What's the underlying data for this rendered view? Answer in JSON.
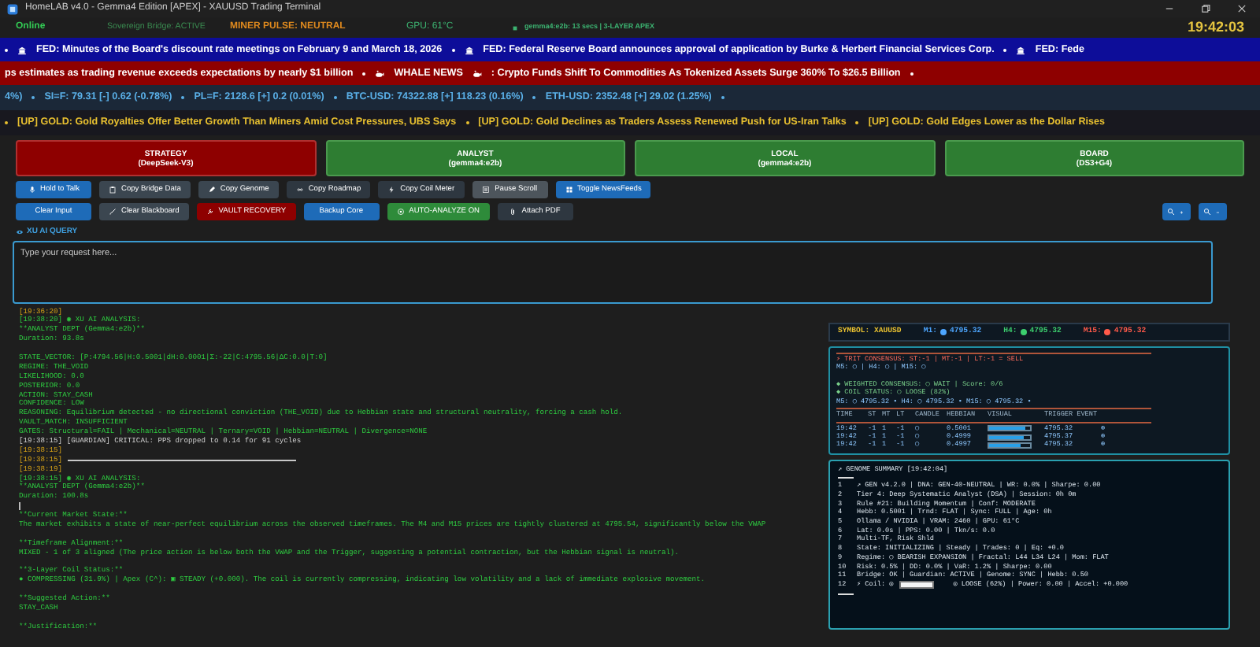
{
  "window": {
    "title": "HomeLAB v4.0 - Gemma4 Edition [APEX] - XAUUSD Trading Terminal"
  },
  "status_bar": [
    {
      "kind": "online",
      "text": "Online"
    },
    {
      "kind": "bridge",
      "text": "Sovereign Bridge: ACTIVE"
    },
    {
      "kind": "pulse",
      "text": "MINER PULSE: NEUTRAL"
    },
    {
      "kind": "gpu",
      "text": "GPU: 61°C"
    },
    {
      "kind": "model",
      "text": "gemma4:e2b: 13 secs | 3-LAYER APEX"
    },
    {
      "kind": "clock",
      "text": "19:42:03"
    }
  ],
  "tickers": [
    {
      "kind": "fed",
      "segments": [
        {
          "kind": "dot"
        },
        {
          "kind": "bank"
        },
        {
          "kind": "text",
          "text": "FED: Minutes of the Board's discount rate meetings on February 9 and March 18, 2026"
        },
        {
          "kind": "dot"
        },
        {
          "kind": "bank"
        },
        {
          "kind": "text",
          "text": "FED: Federal Reserve Board announces approval of application by Burke & Herbert Financial Services Corp."
        },
        {
          "kind": "dot"
        },
        {
          "kind": "bank"
        },
        {
          "kind": "text",
          "text": "FED: Fede"
        }
      ]
    },
    {
      "kind": "whale",
      "segments": [
        {
          "kind": "text",
          "text": "ps estimates as trading revenue exceeds expectations by nearly $1 billion"
        },
        {
          "kind": "dot"
        },
        {
          "kind": "whale"
        },
        {
          "kind": "text",
          "text": "WHALE NEWS"
        },
        {
          "kind": "whale"
        },
        {
          "kind": "text",
          "text": ": Crypto Funds Shift To Commodities As Tokenized Assets Surge 360% To $26.5 Billion"
        },
        {
          "kind": "dot"
        }
      ]
    },
    {
      "kind": "markets",
      "segments": [
        {
          "kind": "text",
          "text": "4%)"
        },
        {
          "kind": "dot"
        },
        {
          "kind": "text",
          "text": "SI=F: 79.31 [-] 0.62 (-0.78%)"
        },
        {
          "kind": "dot"
        },
        {
          "kind": "text",
          "text": "PL=F: 2128.6 [+] 0.2 (0.01%)"
        },
        {
          "kind": "dot"
        },
        {
          "kind": "text",
          "text": "BTC-USD: 74322.88 [+] 118.23 (0.16%)"
        },
        {
          "kind": "dot"
        },
        {
          "kind": "text",
          "text": "ETH-USD: 2352.48 [+] 29.02 (1.25%)"
        },
        {
          "kind": "dot"
        }
      ]
    },
    {
      "kind": "headlines",
      "segments": [
        {
          "kind": "dot"
        },
        {
          "kind": "text",
          "text": "[UP] GOLD: Gold Royalties Offer Better Growth Than Miners Amid Cost Pressures, UBS Says"
        },
        {
          "kind": "dot"
        },
        {
          "kind": "text",
          "text": "[UP] GOLD: Gold Declines as Traders Assess Renewed Push for US-Iran Talks"
        },
        {
          "kind": "dot"
        },
        {
          "kind": "text",
          "text": "[UP] GOLD: Gold Edges Lower as the Dollar Rises"
        }
      ]
    }
  ],
  "agents": [
    {
      "title": "STRATEGY",
      "model": "(DeepSeek-V3)",
      "selected": true
    },
    {
      "title": "ANALYST",
      "model": "(gemma4:e2b)",
      "selected": false
    },
    {
      "title": "LOCAL",
      "model": "(gemma4:e2b)",
      "selected": false
    },
    {
      "title": "BOARD",
      "model": "(DS3+G4)",
      "selected": false
    }
  ],
  "toolbar_rows": [
    [
      {
        "label": "Hold to Talk",
        "kind": "primary"
      },
      {
        "label": "Copy Bridge Data",
        "kind": "secondary"
      },
      {
        "label": "Copy Genome",
        "kind": "secondary"
      },
      {
        "label": "Copy Roadmap",
        "kind": "dark"
      },
      {
        "label": "Copy Coil Meter",
        "kind": "dark"
      },
      {
        "label": "Pause Scroll",
        "kind": "light"
      },
      {
        "label": "Toggle NewsFeeds",
        "kind": "primary"
      }
    ],
    [
      {
        "label": "Clear Input",
        "kind": "primary"
      },
      {
        "label": "Clear Blackboard",
        "kind": "secondary"
      },
      {
        "label": "VAULT RECOVERY",
        "kind": "danger"
      },
      {
        "label": "Backup Core",
        "kind": "primary"
      },
      {
        "label": "AUTO-ANALYZE ON",
        "kind": "success"
      },
      {
        "label": "Attach PDF",
        "kind": "dark"
      }
    ]
  ],
  "zoom_buttons": [
    {
      "kind": "in"
    },
    {
      "kind": "out"
    }
  ],
  "query": {
    "label": "XU AI QUERY",
    "placeholder": "Type your request here..."
  },
  "log": [
    {
      "kind": "time",
      "text": "[19:36:20]"
    },
    {
      "kind": "ai",
      "text": "[19:38:20] ◉ XU AI ANALYSIS:"
    },
    {
      "kind": "ai",
      "text": "**ANALYST DEPT (Gemma4:e2b)**"
    },
    {
      "kind": "ai",
      "text": "Duration: 93.8s"
    },
    {
      "kind": "blank"
    },
    {
      "kind": "ai",
      "text": "STATE_VECTOR: [P:4794.56|H:0.5001|dH:0.0001|Σ:-22|C:4795.56|ΔC:0.0|T:0]"
    },
    {
      "kind": "ai",
      "text": "REGIME: THE_VOID"
    },
    {
      "kind": "ai",
      "text": "LIKELIHOOD: 0.0"
    },
    {
      "kind": "ai",
      "text": "POSTERIOR: 0.0"
    },
    {
      "kind": "ai",
      "text": "ACTION: STAY_CASH"
    },
    {
      "kind": "ai",
      "text": "CONFIDENCE: LOW"
    },
    {
      "kind": "ai",
      "text": "REASONING: Equilibrium detected - no directional conviction (THE_VOID) due to Hebbian state and structural neutrality, forcing a cash hold."
    },
    {
      "kind": "ai",
      "text": "VAULT_MATCH: INSUFFICIENT"
    },
    {
      "kind": "ai",
      "text": "GATES: Structural=FAIL | Mechanical=NEUTRAL | Ternary=VOID | Hebbian=NEUTRAL | Divergence=NONE"
    },
    {
      "kind": "system",
      "text": "[19:38:15] [GUARDIAN] CRITICAL: PPS dropped to 0.14 for 91 cycles"
    },
    {
      "kind": "time",
      "text": "[19:38:15]"
    },
    {
      "kind": "rule",
      "text": "[19:38:15]"
    },
    {
      "kind": "time",
      "text": "[19:38:19]"
    },
    {
      "kind": "ai",
      "text": "[19:38:15] ◉ XU AI ANALYSIS:"
    },
    {
      "kind": "ai",
      "text": "**ANALYST DEPT (Gemma4:e2b)**"
    },
    {
      "kind": "ai",
      "text": "Duration: 100.8s"
    },
    {
      "kind": "cursor"
    },
    {
      "kind": "ai",
      "text": "**Current Market State:**"
    },
    {
      "kind": "ai",
      "text": "The market exhibits a state of near-perfect equilibrium across the observed timeframes. The M4 and M15 prices are tightly clustered at 4795.54, significantly below the VWAP"
    },
    {
      "kind": "blank"
    },
    {
      "kind": "ai",
      "text": "**Timeframe Alignment:**"
    },
    {
      "kind": "ai",
      "text": "MIXED - 1 of 3 aligned (The price action is below both the VWAP and the Trigger, suggesting a potential contraction, but the Hebbian signal is neutral)."
    },
    {
      "kind": "blank"
    },
    {
      "kind": "ai",
      "text": "**3-Layer Coil Status:**"
    },
    {
      "kind": "ai",
      "text": "● COMPRESSING (31.9%) | Apex (C^): ▣ STEADY (+0.000). The coil is currently compressing, indicating low volatility and a lack of immediate explosive movement."
    },
    {
      "kind": "blank"
    },
    {
      "kind": "ai",
      "text": "**Suggested Action:**"
    },
    {
      "kind": "ai",
      "text": "STAY_CASH"
    },
    {
      "kind": "blank"
    },
    {
      "kind": "ai",
      "text": "**Justification:**"
    }
  ],
  "symbol_bar": {
    "symbol": "SYMBOL: XAUUSD",
    "prices": [
      {
        "label": "M1:",
        "value": "4795.32",
        "color": "#4da6ff"
      },
      {
        "label": "H4:",
        "value": "4795.32",
        "color": "#3ccf6e"
      },
      {
        "label": "M15:",
        "value": "4795.32",
        "color": "#ff5a4a"
      }
    ]
  },
  "signal_panel": {
    "lines": [
      {
        "kind": "alert",
        "text": "⚡ TRIT CONSENSUS: ST:-1 | MT:-1 | LT:-1 = SELL"
      },
      {
        "kind": "info",
        "text": "M5: ◯ | H4: ◯ | M15: ◯"
      },
      {
        "kind": "blank"
      },
      {
        "kind": "good",
        "text": "◆ WEIGHTED CONSENSUS: ◯ WAIT | Score: 0/6"
      },
      {
        "kind": "good",
        "text": "◆ COIL STATUS: ◯ LOOSE (82%)"
      },
      {
        "kind": "info",
        "text": "M5: ◯ 4795.32 • H4: ◯ 4795.32 • M15: ◯ 4795.32 •"
      }
    ],
    "table": {
      "columns": [
        "TIME",
        "ST",
        "MT",
        "LT",
        "CANDLE",
        "HEBBIAN",
        "VISUAL",
        "TRIGGER EVENT"
      ],
      "rows": [
        {
          "time": "19:42",
          "st": "-1",
          "mt": "1",
          "lt": "-1",
          "candle": "◯",
          "hebbian": "0.5001",
          "level": 0.9,
          "trigger": "4795.32",
          "event": "⊕"
        },
        {
          "time": "19:42",
          "st": "-1",
          "mt": "1",
          "lt": "-1",
          "candle": "◯",
          "hebbian": "0.4999",
          "level": 0.85,
          "trigger": "4795.37",
          "event": "⊕"
        },
        {
          "time": "19:42",
          "st": "-1",
          "mt": "1",
          "lt": "-1",
          "candle": "◯",
          "hebbian": "0.4997",
          "level": 0.75,
          "trigger": "4795.32",
          "event": "⊕"
        }
      ]
    }
  },
  "genome": {
    "title": "↗ GENOME SUMMARY [19:42:04]",
    "lines": [
      {
        "num": "1",
        "kind": "text",
        "text": "↗ GEN v4.2.0 | DNA: GEN-40-NEUTRAL | WR: 0.0% | Sharpe: 0.00"
      },
      {
        "num": "2",
        "kind": "text",
        "text": "Tier 4: Deep Systematic Analyst (DSA) | Session: 0h 0m"
      },
      {
        "num": "3",
        "kind": "text",
        "text": "Rule #21: Building Momentum | Conf: MODERATE"
      },
      {
        "num": "4",
        "kind": "text",
        "text": "Hebb: 0.5001 | Trnd: FLAT | Sync: FULL | Age: 0h"
      },
      {
        "num": "5",
        "kind": "text",
        "text": "Ollama / NVIDIA | VRAM: 2460 | GPU: 61°C"
      },
      {
        "num": "6",
        "kind": "text",
        "text": "Lat: 0.0s | PPS: 0.00 | Tkn/s: 0.0"
      },
      {
        "num": "7",
        "kind": "text",
        "text": "Multi-TF, Risk Shld"
      },
      {
        "num": "8",
        "kind": "text",
        "text": "State: INITIALIZING | Steady | Trades: 0 | Eq: +0.0"
      },
      {
        "num": "9",
        "kind": "text",
        "text": "Regime: ◯ BEARISH EXPANSION | Fractal: L44 L34 L24 | Mom: FLAT"
      },
      {
        "num": "10",
        "kind": "text",
        "text": "Risk: 0.5% | DD: 0.0% | VaR: 1.2% | Sharpe: 0.00"
      },
      {
        "num": "11",
        "kind": "text",
        "text": "Bridge: OK | Guardian: ACTIVE | Genome: SYNC | Hebb: 0.50"
      },
      {
        "num": "12",
        "kind": "meter",
        "text": "⚡ Coil: ◎",
        "level": 1,
        "after": "◎ LOOSE (62%) | Power: 0.00 | Accel: +0.000"
      }
    ]
  }
}
